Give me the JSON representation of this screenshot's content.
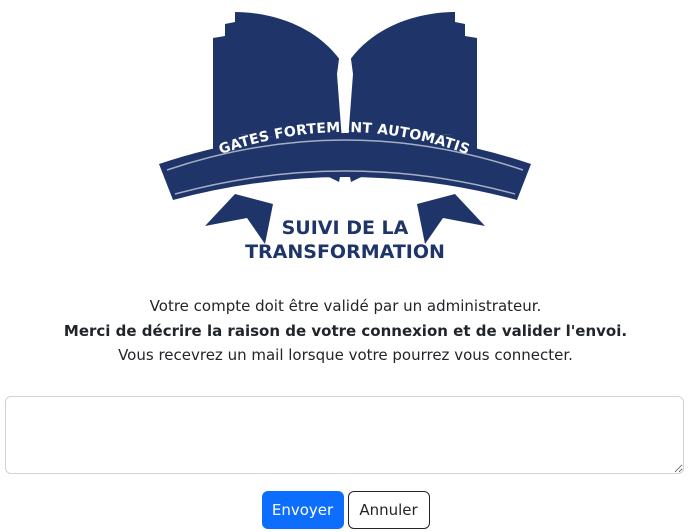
{
  "logo": {
    "banner_text": "FRÉGATES FORTEMENT AUTOMATISÉES",
    "subtitle_line1": "SUIVI DE LA",
    "subtitle_line2": "TRANSFORMATION",
    "icon": "open-book-icon",
    "color": "#1f356a"
  },
  "messages": {
    "line1": "Votre compte doit être validé par un administrateur.",
    "line2": "Merci de décrire la raison de votre connexion et de valider l'envoi.",
    "line3": "Vous recevrez un mail lorsque votre pourrez vous connecter."
  },
  "form": {
    "reason_value": "",
    "submit_label": "Envoyer",
    "cancel_label": "Annuler"
  }
}
